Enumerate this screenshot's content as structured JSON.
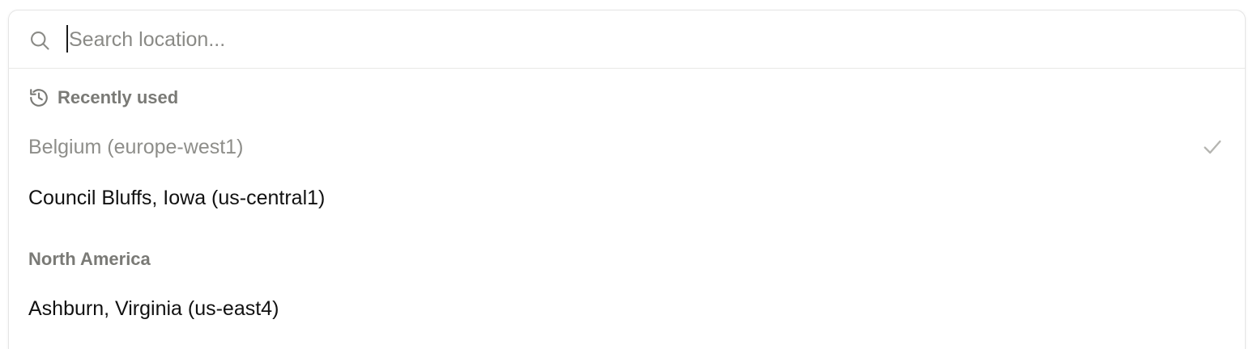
{
  "search": {
    "placeholder": "Search location...",
    "value": ""
  },
  "groups": [
    {
      "label": "Recently used",
      "icon": "history-icon",
      "options": [
        {
          "label": "Belgium (europe-west1)",
          "selected": true
        },
        {
          "label": "Council Bluffs, Iowa (us-central1)",
          "selected": false
        }
      ]
    },
    {
      "label": "North America",
      "options": [
        {
          "label": "Ashburn, Virginia (us-east4)",
          "selected": false
        }
      ]
    }
  ],
  "colors": {
    "text": "#111111",
    "muted": "#8e8e8a",
    "header": "#7a7a76",
    "border": "#e5e5e5"
  }
}
